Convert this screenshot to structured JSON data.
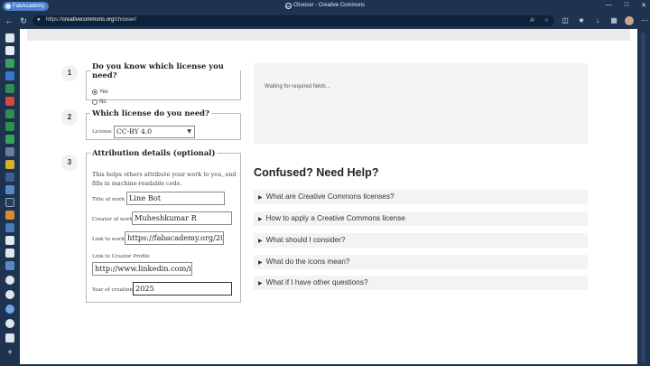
{
  "browser": {
    "profile_label": "FabAcademy",
    "window_title": "Chooser - Creative Commons",
    "url_prefix": "https://",
    "url_domain": "creativecommons.org",
    "url_path": "/chooser/"
  },
  "steps": [
    {
      "number": "1",
      "title": "Do you know which license you need?"
    },
    {
      "number": "2",
      "title": "Which license do you need?"
    },
    {
      "number": "3",
      "title": "Attribution details (optional)"
    }
  ],
  "license_known": {
    "options": [
      "Yes",
      "No"
    ],
    "selected": "Yes"
  },
  "license_select": {
    "label": "License",
    "value": "CC-BY 4.0"
  },
  "attribution": {
    "help_line1": "This helps others attribute your work to you, and",
    "help_line2": "fills in machine-readable code.",
    "title_of_work_label": "Title of work",
    "title_of_work_value": "Line Bot",
    "creator_label": "Creator of work",
    "creator_value": "Muheshkumar R",
    "link_to_work_label": "Link to work",
    "link_to_work_value": "https://fabacademy.org/20",
    "creator_profile_label": "Link to Creator Profile",
    "creator_profile_value": "http://www.linkedin.com/i",
    "year_label": "Year of creation",
    "year_value": "2025"
  },
  "result": {
    "waiting_text": "Waiting for required fields..."
  },
  "help": {
    "title": "Confused? Need Help?",
    "items": [
      "What are Creative Commons licenses?",
      "How to apply a Creative Commons license",
      "What should I consider?",
      "What do the icons mean?",
      "What if I have other questions?"
    ]
  },
  "icons": {
    "faq_arrow": "triangle-right-icon"
  }
}
